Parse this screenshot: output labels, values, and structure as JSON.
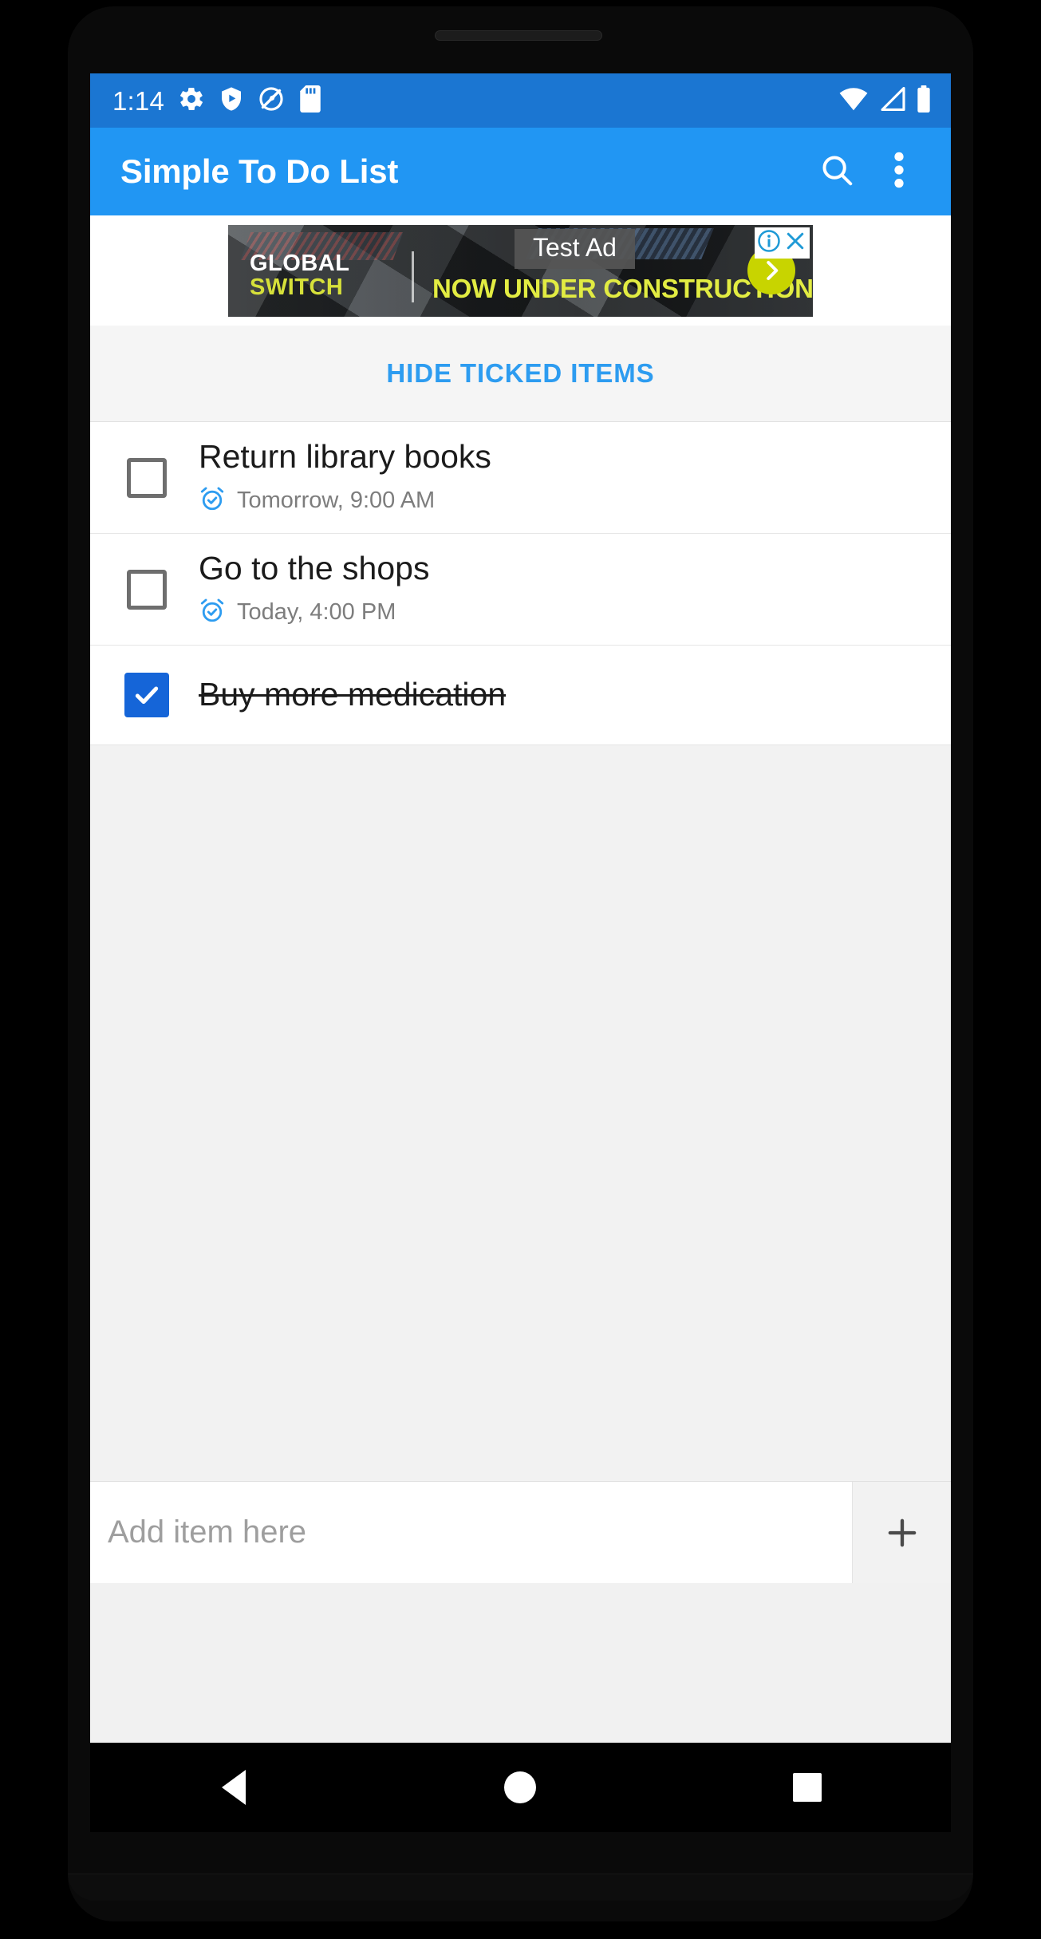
{
  "status_bar": {
    "clock": "1:14",
    "left_icons": [
      "gear-icon",
      "shield-play-icon",
      "location-slash-icon",
      "sd-card-icon"
    ],
    "right_icons": [
      "wifi-icon",
      "cellular-signal-icon",
      "battery-icon"
    ],
    "background_color": "#1b76d2"
  },
  "app_bar": {
    "title": "Simple To Do List",
    "background_color": "#2196f3",
    "actions": [
      {
        "name": "search-icon",
        "label": "Search"
      },
      {
        "name": "overflow-menu-icon",
        "label": "More options"
      }
    ]
  },
  "ad": {
    "test_label": "Test Ad",
    "brand_line1": "GLOBAL",
    "brand_line2": "SWITCH",
    "headline": "NOW UNDER CONSTRUCTION",
    "info_badge": "i",
    "close_badge": "✕",
    "cta_glyph": "›",
    "brand_accent_color": "#d6e03a",
    "cta_color": "#c8d400"
  },
  "list": {
    "hide_ticked_label": "HIDE TICKED ITEMS",
    "hide_ticked_color": "#2d9cf0",
    "items": [
      {
        "title": "Return library books",
        "reminder": "Tomorrow, 9:00 AM",
        "checked": false,
        "has_reminder": true
      },
      {
        "title": "Go to the shops",
        "reminder": "Today, 4:00 PM",
        "checked": false,
        "has_reminder": true
      },
      {
        "title": "Buy more medication",
        "reminder": "",
        "checked": true,
        "has_reminder": false
      }
    ]
  },
  "add_bar": {
    "placeholder": "Add item here",
    "value": "",
    "add_glyph": "+"
  },
  "nav_bar": {
    "back_label": "Back",
    "home_label": "Home",
    "recents_label": "Recent apps"
  }
}
